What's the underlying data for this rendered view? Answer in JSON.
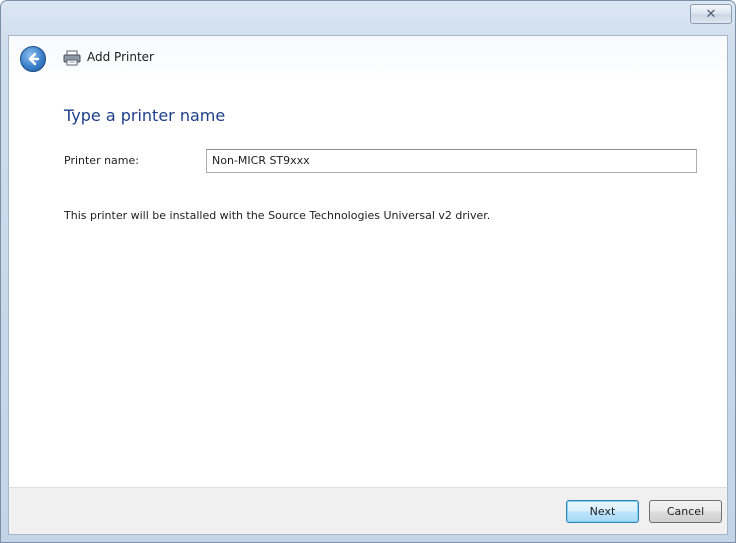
{
  "window": {
    "title": "Add Printer",
    "close_glyph": "✕"
  },
  "icons": {
    "back": "back-arrow-icon",
    "printer": "printer-icon",
    "close": "close-icon"
  },
  "main": {
    "heading": "Type a printer name",
    "printer_name_label": "Printer name:",
    "printer_name_value": "Non-MICR ST9xxx",
    "info_text": "This printer will be installed with the Source Technologies Universal v2 driver."
  },
  "footer": {
    "next_label": "Next",
    "cancel_label": "Cancel"
  },
  "colors": {
    "heading": "#1e3f8a",
    "frame": "#c3d4e7",
    "footer": "#f0f0f0"
  }
}
